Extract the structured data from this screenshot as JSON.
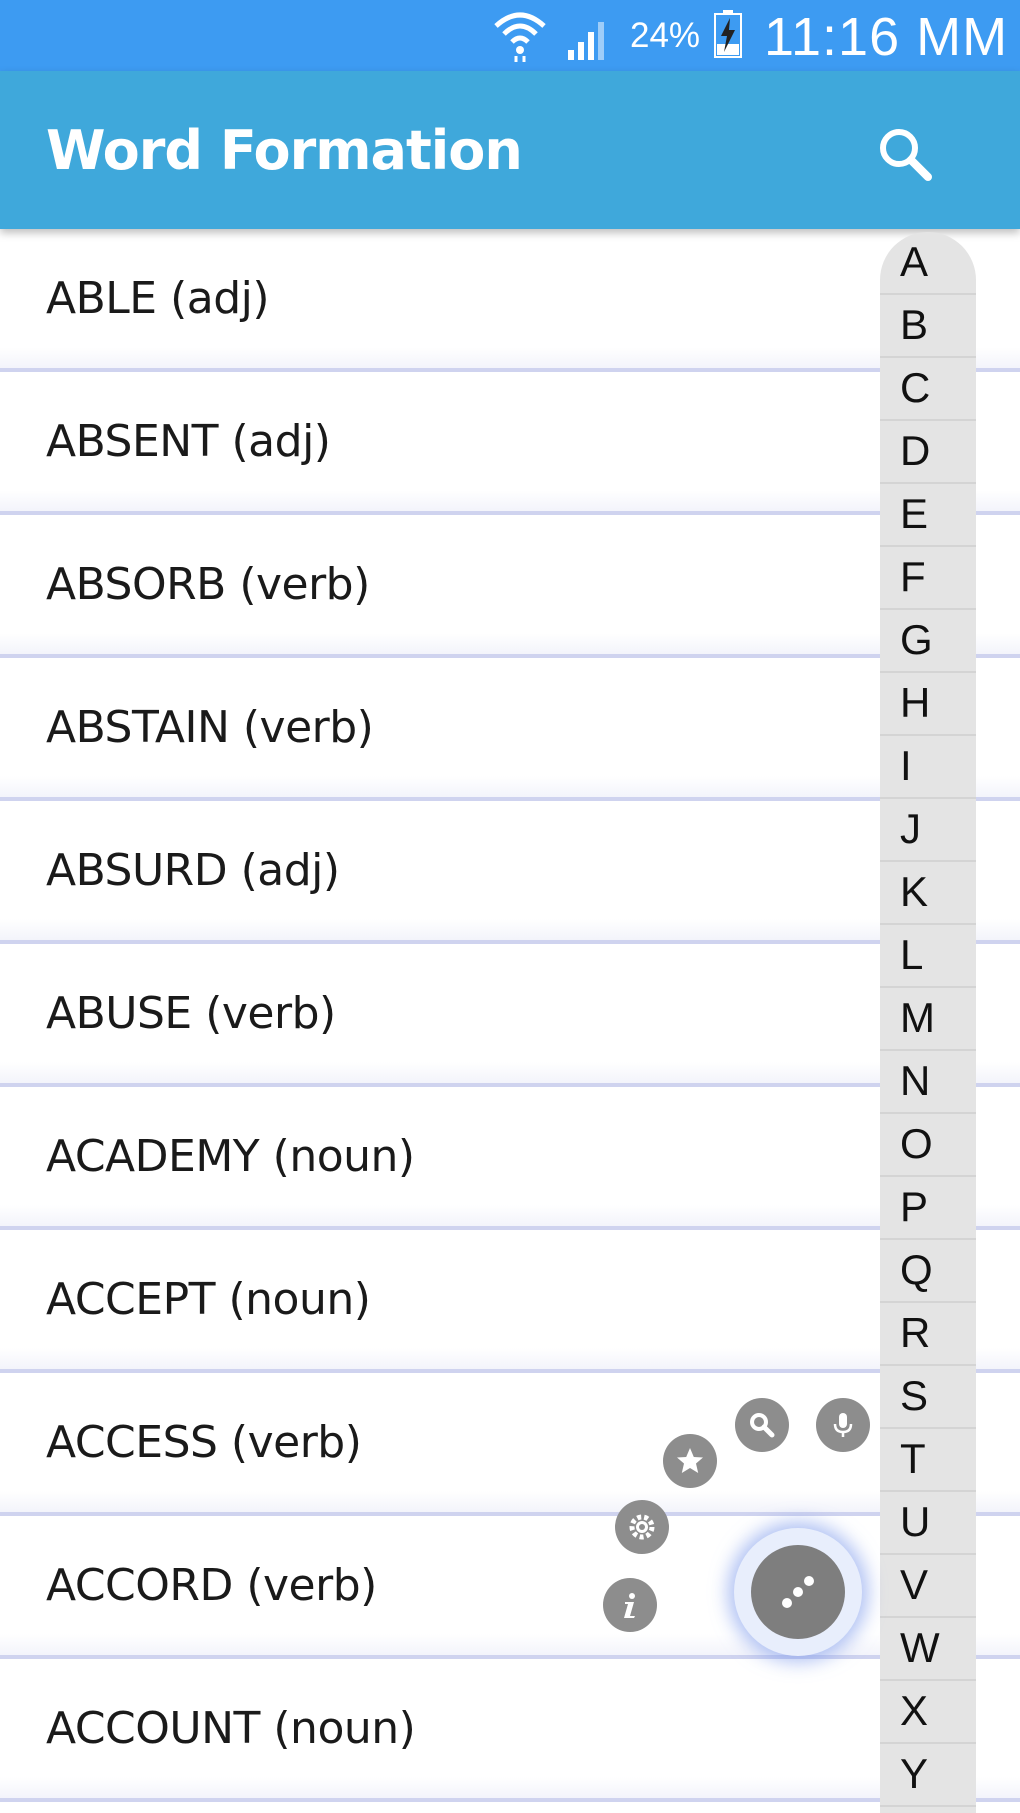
{
  "status_bar": {
    "battery_percent": "24%",
    "time": "11:16 MM",
    "icons": [
      "wifi-icon",
      "signal-icon",
      "battery-charging-icon"
    ]
  },
  "app_bar": {
    "title": "Word Formation",
    "search_icon": "search-icon"
  },
  "words": [
    "ABLE (adj)",
    "ABSENT (adj)",
    "ABSORB (verb)",
    "ABSTAIN (verb)",
    "ABSURD (adj)",
    "ABUSE (verb)",
    "ACADEMY (noun)",
    "ACCEPT (noun)",
    "ACCESS (verb)",
    "ACCORD (verb)",
    "ACCOUNT (noun)"
  ],
  "alphabet": [
    "A",
    "B",
    "C",
    "D",
    "E",
    "F",
    "G",
    "H",
    "I",
    "J",
    "K",
    "L",
    "M",
    "N",
    "O",
    "P",
    "Q",
    "R",
    "S",
    "T",
    "U",
    "V",
    "W",
    "X",
    "Y"
  ],
  "fab_menu": {
    "items": [
      "info-icon",
      "settings-icon",
      "star-icon",
      "search-icon",
      "microphone-icon"
    ],
    "main_icon": "dots-icon"
  },
  "colors": {
    "status_bar": "#3d9bf2",
    "app_bar": "#3fa8db",
    "fab": "#8d8d8d"
  }
}
